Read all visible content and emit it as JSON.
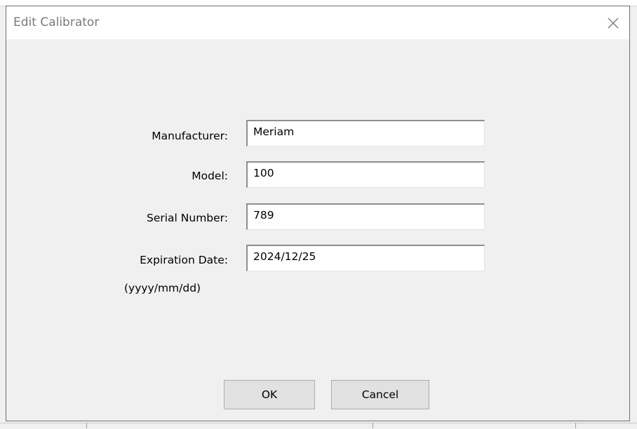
{
  "dialog": {
    "title": "Edit Calibrator",
    "close_icon": "close-icon"
  },
  "form": {
    "manufacturer_label": "Manufacturer:",
    "manufacturer_value": "Meriam",
    "model_label": "Model:",
    "model_value": "100",
    "serial_label": "Serial Number:",
    "serial_value": "789",
    "expiration_label": "Expiration Date:",
    "expiration_hint": "(yyyy/mm/dd)",
    "expiration_value": "2024/12/25"
  },
  "buttons": {
    "ok_label": "OK",
    "cancel_label": "Cancel"
  }
}
